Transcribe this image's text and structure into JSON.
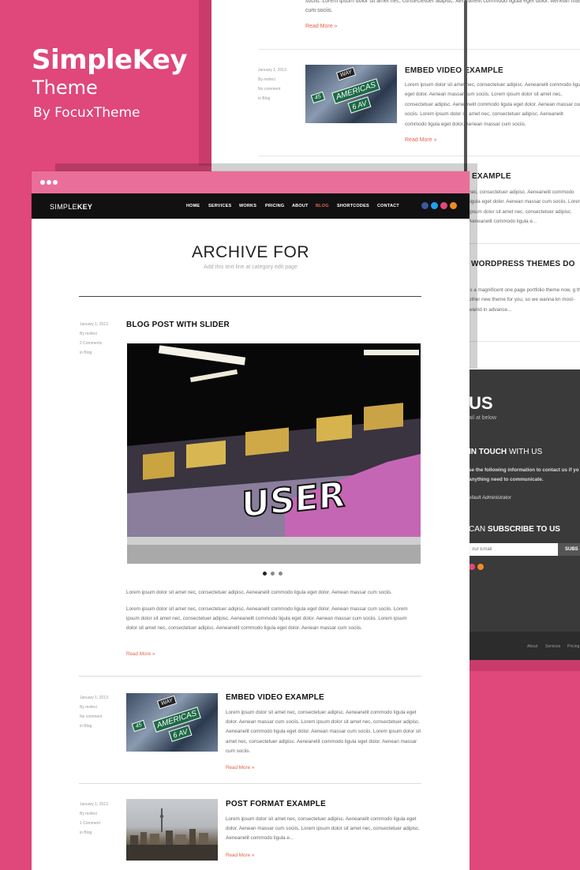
{
  "hero": {
    "title": "SimpleKey",
    "subtitle": "Theme",
    "byline": "By FocuxTheme"
  },
  "back_page": {
    "top_text": "sociis. Lorem ipsum dolor sit amet nec, consectetuer adipisc. Aeneanelit commodo ligula eget dolor. Aenean massar cum sociis.",
    "read_more": "Read More »",
    "post1": {
      "meta": [
        "January 1, 2013",
        "By mxfect",
        "No comment",
        "in Blog"
      ],
      "title": "EMBED VIDEO EXAMPLE",
      "text": "Lorem ipsum dolor sit amet nec, consectetuer adipisc. Aeneanelit commodo ligula eget dolor. Aenean massar cum sociis. Lorem ipsum dolor sit amet nec, consectetuer adipisc. Aeneanelit commodo ligula eget dolor. Aenean massar cum sociis. Lorem ipsum dolor sit amet nec, consectetuer adipisc. Aeneanelit commodo ligula eget dolor. Aenean massar cum sociis.",
      "read_more": "Read More »"
    },
    "post2": {
      "title": "EXAMPLE",
      "text": "nec, consectetuer adipisc. Aeneanelit commodo ligula eget dolor. Aenean massar cum sociis. Lorem ipsum dolor sit amet nec, consectetuer adipisc. Aeneanelit commodo ligula e..."
    },
    "post3": {
      "title": "WORDPRESS THEMES DO",
      "text": "is a magnificent one page portfolio theme now, g the other new theme for you, so we wanna kn most-wantd in advance..."
    },
    "contact": {
      "heading": "US",
      "heading_sub": "ail at below",
      "get_in_touch_bold": "IN TOUCH",
      "get_in_touch_rest": "WITH US",
      "touch_text": "se the following information to contact us if yo anything need to communicate.",
      "admin": "efault Administrator",
      "subscribe_pre": "CAN",
      "subscribe_bold": "SUBSCRIBE TO US",
      "email_placeholder": "our Email",
      "subscribe_button": "SUBS"
    },
    "footer_links": [
      "About",
      "Services",
      "Pricing"
    ]
  },
  "nav": {
    "logo_light": "SIMPLE",
    "logo_bold": "KEY",
    "items": [
      "HOME",
      "SERVICES",
      "WORKS",
      "PRICING",
      "ABOUT",
      "BLOG",
      "SHORTCODES",
      "CONTACT"
    ],
    "active": "BLOG"
  },
  "archive": {
    "title": "ARCHIVE FOR",
    "subtitle": "Add this text line at category edit page"
  },
  "posts": [
    {
      "meta": [
        "January 1, 2013",
        "By mxfect",
        "2 Comments",
        "in Blog"
      ],
      "title": "BLOG POST WITH SLIDER",
      "p1": "Lorem ipsum dolor sit amet nec, consectetuer adipisc. Aeneanelit commodo ligula eget dolor. Aenean massar cum sociis.",
      "p2": "Lorem ipsum dolor sit amet nec, consectetuer adipisc. Aeneanelit commodo ligula eget dolor. Aenean massar cum sociis. Lorem ipsum dolor sit amet nec, consectetuer adipisc. Aeneanelit commodo ligula eget dolor. Aenean massar cum sociis. Lorem ipsum dolor sit amet nec, consectetuer adipisc. Aeneanelit commodo ligula eget dolor. Aenean massar cum sociis.",
      "read_more": "Read More »"
    },
    {
      "meta": [
        "January 1, 2013",
        "By mxfect",
        "No comment",
        "in Blog"
      ],
      "title": "EMBED VIDEO EXAMPLE",
      "text": "Lorem ipsum dolor sit amet nec, consectetuer adipisc. Aeneanelit commodo ligula eget dolor. Aenean massar cum sociis. Lorem ipsum dolor sit amet nec, consectetuer adipisc. Aeneanelit commodo ligula eget dolor. Aenean massar cum sociis. Lorem ipsum dolor sit amet nec, consectetuer adipisc. Aeneanelit commodo ligula eget dolor. Aenean massar cum sociis.",
      "read_more": "Read More »"
    },
    {
      "meta": [
        "January 1, 2013",
        "By mxfect",
        "1 Comment",
        "in Blog"
      ],
      "title": "POST FORMAT EXAMPLE",
      "text": "Lorem ipsum dolor sit amet nec, consectetuer adipisc. Aeneanelit commodo ligula eget dolor. Aenean massar cum sociis. Lorem ipsum dolor sit amet nec, consectetuer adipisc. Aeneanelit commodo ligula e...",
      "read_more": "Read More »"
    }
  ],
  "sign_text": {
    "way": "WAY",
    "americas": "AMERICAS",
    "sixth": "6 AV",
    "num": "45"
  },
  "slider": {
    "slides": 3,
    "active_index": 0
  },
  "colors": {
    "brand_pink": "#e0477b",
    "accent": "#e8604c",
    "nav_bg": "#111111"
  }
}
